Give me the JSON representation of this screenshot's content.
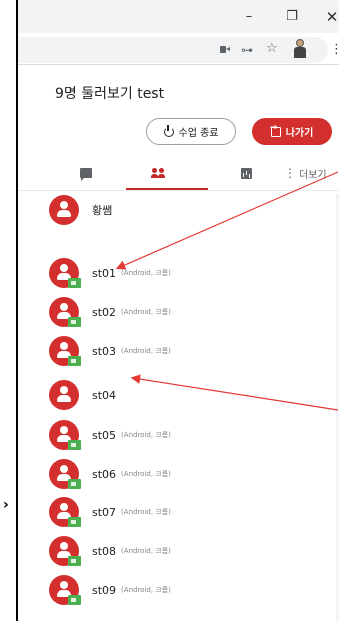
{
  "window": {
    "minimize_glyph": "–",
    "maximize_glyph": "❐",
    "close_glyph": "✕"
  },
  "toolbar": {
    "icons": [
      "camera-icon",
      "key-icon",
      "star-icon",
      "profile-icon",
      "menu-icon"
    ],
    "key_glyph": "⊶",
    "star_glyph": "☆",
    "menu_glyph": "⋮"
  },
  "class": {
    "title": "9명 둘러보기 test"
  },
  "actions": {
    "end_label": "수업 종료",
    "exit_label": "나가기"
  },
  "tabs": {
    "more_label": "더보기",
    "active": "people"
  },
  "colors": {
    "accent": "#d32f2f",
    "video_badge": "#4caf50",
    "annotation_arrow": "#e53935"
  },
  "participants": [
    {
      "name": "황쌤",
      "device": "",
      "video": false
    },
    {
      "name": "st01",
      "device": "(Android, 크롬)",
      "video": true
    },
    {
      "name": "st02",
      "device": "(Android, 크롬)",
      "video": true
    },
    {
      "name": "st03",
      "device": "(Android, 크롬)",
      "video": true
    },
    {
      "name": "st04",
      "device": "",
      "video": false
    },
    {
      "name": "st05",
      "device": "(Android, 크롬)",
      "video": true
    },
    {
      "name": "st06",
      "device": "(Android, 크롬)",
      "video": true
    },
    {
      "name": "st07",
      "device": "(Android, 크롬)",
      "video": true
    },
    {
      "name": "st08",
      "device": "(Android, 크롬)",
      "video": true
    },
    {
      "name": "st09",
      "device": "(Android, 크롬)",
      "video": true
    }
  ],
  "sidebar": {
    "chevron_glyph": "›"
  }
}
